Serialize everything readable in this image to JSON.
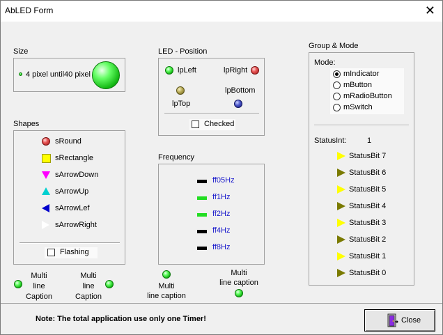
{
  "window": {
    "title": "AbLED Form"
  },
  "size": {
    "label": "Size",
    "text": "4 pixel until40 pixel"
  },
  "led_position": {
    "label": "LED - Position",
    "left": "lpLeft",
    "right": "lpRight",
    "top": "lpTop",
    "bottom": "lpBottom",
    "checked": "Checked"
  },
  "shapes": {
    "label": "Shapes",
    "items": [
      {
        "label": "sRound",
        "color": "#e83030"
      },
      {
        "label": "sRectangle",
        "color": "#ffff00"
      },
      {
        "label": "sArrowDown",
        "color": "#ff00ff"
      },
      {
        "label": "sArrowUp",
        "color": "#00d0d0"
      },
      {
        "label": "sArrowLef",
        "color": "#0000cc"
      },
      {
        "label": "sArrowRight",
        "color": "#ffffff"
      }
    ],
    "flashing": "Flashing"
  },
  "frequency": {
    "label": "Frequency",
    "items": [
      {
        "label": "ff05Hz",
        "color": "#000000"
      },
      {
        "label": "ff1Hz",
        "color": "#22dd22"
      },
      {
        "label": "ff2Hz",
        "color": "#22dd22"
      },
      {
        "label": "ff4Hz",
        "color": "#000000"
      },
      {
        "label": "ff8Hz",
        "color": "#000000"
      }
    ]
  },
  "group_mode": {
    "label": "Group & Mode",
    "mode_label": "Mode:",
    "modes": [
      "mIndicator",
      "mButton",
      "mRadioButton",
      "mSwitch"
    ],
    "selected_mode": "mIndicator",
    "status_int_label": "StatusInt:",
    "status_int_value": "1",
    "status_bits": [
      {
        "label": "StatusBit 7",
        "color": "#ffff00"
      },
      {
        "label": "StatusBit 6",
        "color": "#7a7a00"
      },
      {
        "label": "StatusBit 5",
        "color": "#ffff00"
      },
      {
        "label": "StatusBit 4",
        "color": "#7a7a00"
      },
      {
        "label": "StatusBit 3",
        "color": "#ffff00"
      },
      {
        "label": "StatusBit 2",
        "color": "#7a7a00"
      },
      {
        "label": "StatusBit 1",
        "color": "#ffff00"
      },
      {
        "label": "StatusBit 0",
        "color": "#7a7a00"
      }
    ]
  },
  "multi_captions": {
    "a": [
      "Multi",
      "line",
      "Caption"
    ],
    "b": [
      "Multi",
      "line",
      "Caption"
    ],
    "c": [
      "Multi",
      "line caption"
    ],
    "d": [
      "Multi",
      "line caption"
    ]
  },
  "footer": {
    "note": "Note: The total application use only one Timer!",
    "close_label": "Close"
  }
}
